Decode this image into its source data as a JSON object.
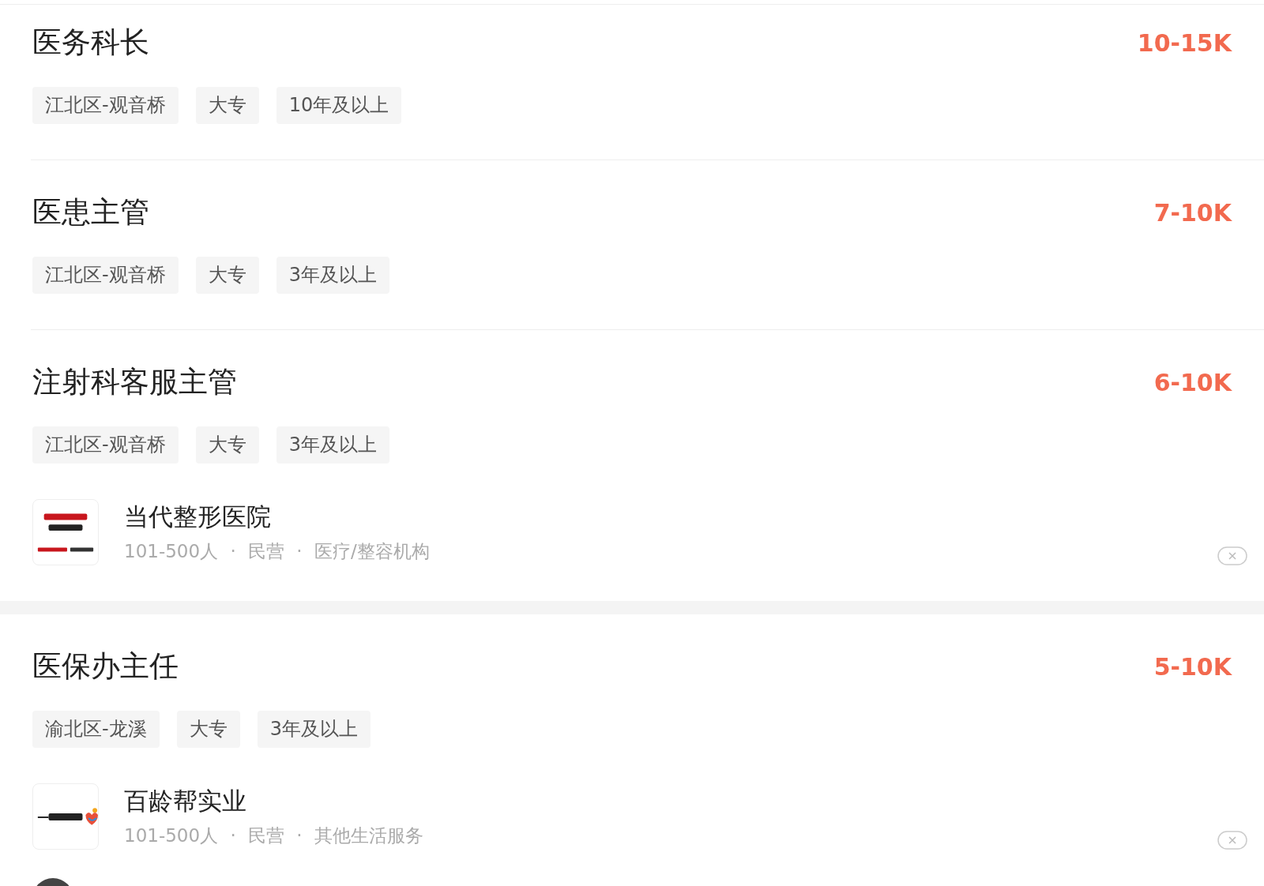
{
  "jobs": [
    {
      "title": "医务科长",
      "salary": "10-15K",
      "tags": [
        "江北区-观音桥",
        "大专",
        "10年及以上"
      ]
    },
    {
      "title": "医患主管",
      "salary": "7-10K",
      "tags": [
        "江北区-观音桥",
        "大专",
        "3年及以上"
      ]
    },
    {
      "title": "注射科客服主管",
      "salary": "6-10K",
      "tags": [
        "江北区-观音桥",
        "大专",
        "3年及以上"
      ],
      "company": {
        "name": "当代整形医院",
        "meta": "101-500人 · 民营 · 医疗/整容机构"
      }
    },
    {
      "title": "医保办主任",
      "salary": "5-10K",
      "tags": [
        "渝北区-龙溪",
        "大专",
        "3年及以上"
      ],
      "company": {
        "name": "百龄帮实业",
        "meta": "101-500人 · 民营 · 其他生活服务"
      }
    }
  ]
}
